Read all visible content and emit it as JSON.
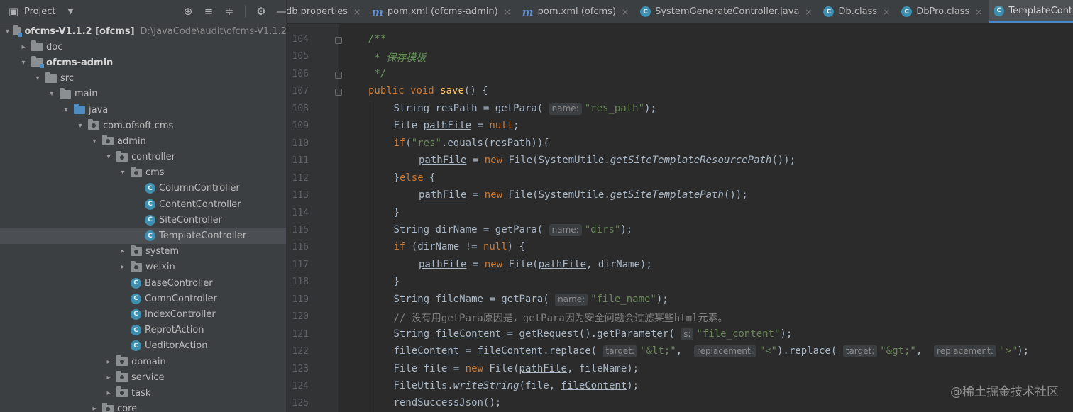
{
  "project_panel": {
    "title": "Project",
    "tree": [
      {
        "depth": 0,
        "arrow": "down",
        "icon": "module-folder",
        "label": "ofcms-V1.1.2 [ofcms]",
        "path": "D:\\JavaCode\\audit\\ofcms-V1.1.2",
        "bold": true
      },
      {
        "depth": 1,
        "arrow": "right",
        "icon": "folder",
        "label": "doc"
      },
      {
        "depth": 1,
        "arrow": "down",
        "icon": "module-folder",
        "label": "ofcms-admin",
        "bold": true
      },
      {
        "depth": 2,
        "arrow": "down",
        "icon": "folder",
        "label": "src"
      },
      {
        "depth": 3,
        "arrow": "down",
        "icon": "folder",
        "label": "main"
      },
      {
        "depth": 4,
        "arrow": "down",
        "icon": "source-folder",
        "label": "java"
      },
      {
        "depth": 5,
        "arrow": "down",
        "icon": "package",
        "label": "com.ofsoft.cms"
      },
      {
        "depth": 6,
        "arrow": "down",
        "icon": "package",
        "label": "admin"
      },
      {
        "depth": 7,
        "arrow": "down",
        "icon": "package",
        "label": "controller"
      },
      {
        "depth": 8,
        "arrow": "down",
        "icon": "package",
        "label": "cms"
      },
      {
        "depth": 9,
        "arrow": "none",
        "icon": "class",
        "label": "ColumnController"
      },
      {
        "depth": 9,
        "arrow": "none",
        "icon": "class",
        "label": "ContentController"
      },
      {
        "depth": 9,
        "arrow": "none",
        "icon": "class",
        "label": "SiteController"
      },
      {
        "depth": 9,
        "arrow": "none",
        "icon": "class",
        "label": "TemplateController",
        "selected": true
      },
      {
        "depth": 8,
        "arrow": "right",
        "icon": "package",
        "label": "system"
      },
      {
        "depth": 8,
        "arrow": "right",
        "icon": "package",
        "label": "weixin"
      },
      {
        "depth": 8,
        "arrow": "none",
        "icon": "class",
        "label": "BaseController"
      },
      {
        "depth": 8,
        "arrow": "none",
        "icon": "class",
        "label": "ComnController"
      },
      {
        "depth": 8,
        "arrow": "none",
        "icon": "class",
        "label": "IndexController"
      },
      {
        "depth": 8,
        "arrow": "none",
        "icon": "class",
        "label": "ReprotAction"
      },
      {
        "depth": 8,
        "arrow": "none",
        "icon": "class",
        "label": "UeditorAction"
      },
      {
        "depth": 7,
        "arrow": "right",
        "icon": "package",
        "label": "domain"
      },
      {
        "depth": 7,
        "arrow": "right",
        "icon": "package",
        "label": "service"
      },
      {
        "depth": 7,
        "arrow": "right",
        "icon": "package",
        "label": "task"
      },
      {
        "depth": 6,
        "arrow": "right",
        "icon": "package",
        "label": "core"
      }
    ]
  },
  "tabs": [
    {
      "label": "db.properties",
      "icon": "none",
      "active": false
    },
    {
      "label": "pom.xml (ofcms-admin)",
      "icon": "maven",
      "active": false
    },
    {
      "label": "pom.xml (ofcms)",
      "icon": "maven",
      "active": false
    },
    {
      "label": "SystemGenerateController.java",
      "icon": "class",
      "active": false
    },
    {
      "label": "Db.class",
      "icon": "class",
      "active": false
    },
    {
      "label": "DbPro.class",
      "icon": "class",
      "active": false
    },
    {
      "label": "TemplateController.java",
      "icon": "class",
      "active": true
    }
  ],
  "editor": {
    "lines": [
      {
        "n": "104",
        "indent": 1,
        "tokens": [
          [
            "doc",
            "/**"
          ]
        ]
      },
      {
        "n": "105",
        "indent": 1,
        "tokens": [
          [
            "doc",
            " * 保存模板"
          ]
        ]
      },
      {
        "n": "106",
        "indent": 1,
        "tokens": [
          [
            "doc",
            " */"
          ]
        ]
      },
      {
        "n": "107",
        "indent": 1,
        "tokens": [
          [
            "kw",
            "public "
          ],
          [
            "kw",
            "void "
          ],
          [
            "fn",
            "save"
          ],
          [
            "t",
            "() {"
          ]
        ]
      },
      {
        "n": "108",
        "indent": 2,
        "tokens": [
          [
            "t",
            "String resPath = getPara( "
          ],
          [
            "hint",
            "name:"
          ],
          [
            "str",
            "\"res_path\""
          ],
          [
            "t",
            ");"
          ]
        ]
      },
      {
        "n": "109",
        "indent": 2,
        "tokens": [
          [
            "t",
            "File "
          ],
          [
            "fld",
            "pathFile"
          ],
          [
            "t",
            " = "
          ],
          [
            "kw",
            "null"
          ],
          [
            "t",
            ";"
          ]
        ]
      },
      {
        "n": "110",
        "indent": 2,
        "tokens": [
          [
            "kw",
            "if"
          ],
          [
            "t",
            "("
          ],
          [
            "str",
            "\"res\""
          ],
          [
            "t",
            ".equals(resPath)){"
          ]
        ]
      },
      {
        "n": "111",
        "indent": 3,
        "tokens": [
          [
            "fld",
            "pathFile"
          ],
          [
            "t",
            " = "
          ],
          [
            "kw",
            "new "
          ],
          [
            "t",
            "File(SystemUtile."
          ],
          [
            "st",
            "getSiteTemplateResourcePath"
          ],
          [
            "t",
            "());"
          ]
        ]
      },
      {
        "n": "112",
        "indent": 2,
        "tokens": [
          [
            "t",
            "}"
          ],
          [
            "kw",
            "else "
          ],
          [
            "t",
            "{"
          ]
        ]
      },
      {
        "n": "113",
        "indent": 3,
        "tokens": [
          [
            "fld",
            "pathFile"
          ],
          [
            "t",
            " = "
          ],
          [
            "kw",
            "new "
          ],
          [
            "t",
            "File(SystemUtile."
          ],
          [
            "st",
            "getSiteTemplatePath"
          ],
          [
            "t",
            "());"
          ]
        ]
      },
      {
        "n": "114",
        "indent": 2,
        "tokens": [
          [
            "t",
            "}"
          ]
        ]
      },
      {
        "n": "115",
        "indent": 2,
        "tokens": [
          [
            "t",
            "String dirName = getPara( "
          ],
          [
            "hint",
            "name:"
          ],
          [
            "str",
            "\"dirs\""
          ],
          [
            "t",
            ");"
          ]
        ]
      },
      {
        "n": "116",
        "indent": 2,
        "tokens": [
          [
            "kw",
            "if "
          ],
          [
            "t",
            "(dirName != "
          ],
          [
            "kw",
            "null"
          ],
          [
            "t",
            ") {"
          ]
        ]
      },
      {
        "n": "117",
        "indent": 3,
        "tokens": [
          [
            "fld",
            "pathFile"
          ],
          [
            "t",
            " = "
          ],
          [
            "kw",
            "new "
          ],
          [
            "t",
            "File("
          ],
          [
            "fld",
            "pathFile"
          ],
          [
            "t",
            ", dirName);"
          ]
        ]
      },
      {
        "n": "118",
        "indent": 2,
        "tokens": [
          [
            "t",
            "}"
          ]
        ]
      },
      {
        "n": "119",
        "indent": 2,
        "tokens": [
          [
            "t",
            "String fileName = getPara( "
          ],
          [
            "hint",
            "name:"
          ],
          [
            "str",
            "\"file_name\""
          ],
          [
            "t",
            ");"
          ]
        ]
      },
      {
        "n": "120",
        "indent": 2,
        "tokens": [
          [
            "cmt",
            "// 没有用getPara原因是，getPara因为安全问题会过滤某些html元素。"
          ]
        ]
      },
      {
        "n": "121",
        "indent": 2,
        "tokens": [
          [
            "t",
            "String "
          ],
          [
            "fld",
            "fileContent"
          ],
          [
            "t",
            " = getRequest().getParameter( "
          ],
          [
            "hint",
            "s:"
          ],
          [
            "str",
            "\"file_content\""
          ],
          [
            "t",
            ");"
          ]
        ]
      },
      {
        "n": "122",
        "indent": 2,
        "tokens": [
          [
            "fld",
            "fileContent"
          ],
          [
            "t",
            " = "
          ],
          [
            "fld",
            "fileContent"
          ],
          [
            "t",
            ".replace( "
          ],
          [
            "hint",
            "target:"
          ],
          [
            "str",
            "\"&lt;\""
          ],
          [
            "t",
            ",  "
          ],
          [
            "hint",
            "replacement:"
          ],
          [
            "str",
            "\"<\""
          ],
          [
            "t",
            ").replace( "
          ],
          [
            "hint",
            "target:"
          ],
          [
            "str",
            "\"&gt;\""
          ],
          [
            "t",
            ",  "
          ],
          [
            "hint",
            "replacement:"
          ],
          [
            "str",
            "\">\""
          ],
          [
            "t",
            ");"
          ]
        ]
      },
      {
        "n": "123",
        "indent": 2,
        "tokens": [
          [
            "t",
            "File file = "
          ],
          [
            "kw",
            "new "
          ],
          [
            "t",
            "File("
          ],
          [
            "fld",
            "pathFile"
          ],
          [
            "t",
            ", fileName);"
          ]
        ]
      },
      {
        "n": "124",
        "indent": 2,
        "tokens": [
          [
            "t",
            "FileUtils."
          ],
          [
            "st",
            "writeString"
          ],
          [
            "t",
            "(file, "
          ],
          [
            "fld",
            "fileContent"
          ],
          [
            "t",
            ");"
          ]
        ]
      },
      {
        "n": "125",
        "indent": 2,
        "tokens": [
          [
            "t",
            "rendSuccessJson();"
          ]
        ]
      }
    ],
    "watermark": "@稀土掘金技术社区"
  },
  "colors": {
    "panel_bg": "#3c3f41",
    "editor_bg": "#2b2b2b",
    "keyword": "#cc7832",
    "string": "#6a8759",
    "doc_comment": "#629755",
    "method": "#ffc66d",
    "active_tab_underline": "#4a88c7"
  }
}
